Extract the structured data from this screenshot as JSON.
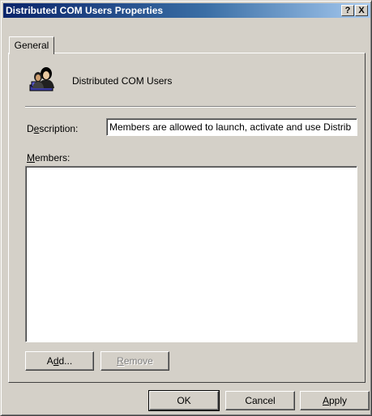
{
  "window": {
    "title": "Distributed COM Users Properties",
    "help_button": "?",
    "close_button": "X"
  },
  "tabs": [
    {
      "label": "General"
    }
  ],
  "group": {
    "icon": "user-group-icon",
    "name": "Distributed COM Users"
  },
  "description": {
    "label_pre": "D",
    "label_key": "e",
    "label_post": "scription:",
    "value": "Members are allowed to launch, activate and use Distrib"
  },
  "members": {
    "label_key": "M",
    "label_post": "embers:",
    "items": []
  },
  "member_buttons": {
    "add_pre": "A",
    "add_key": "d",
    "add_post": "d...",
    "remove_key": "R",
    "remove_post": "emove"
  },
  "dialog_buttons": {
    "ok": "OK",
    "cancel": "Cancel",
    "apply_key": "A",
    "apply_post": "pply"
  }
}
